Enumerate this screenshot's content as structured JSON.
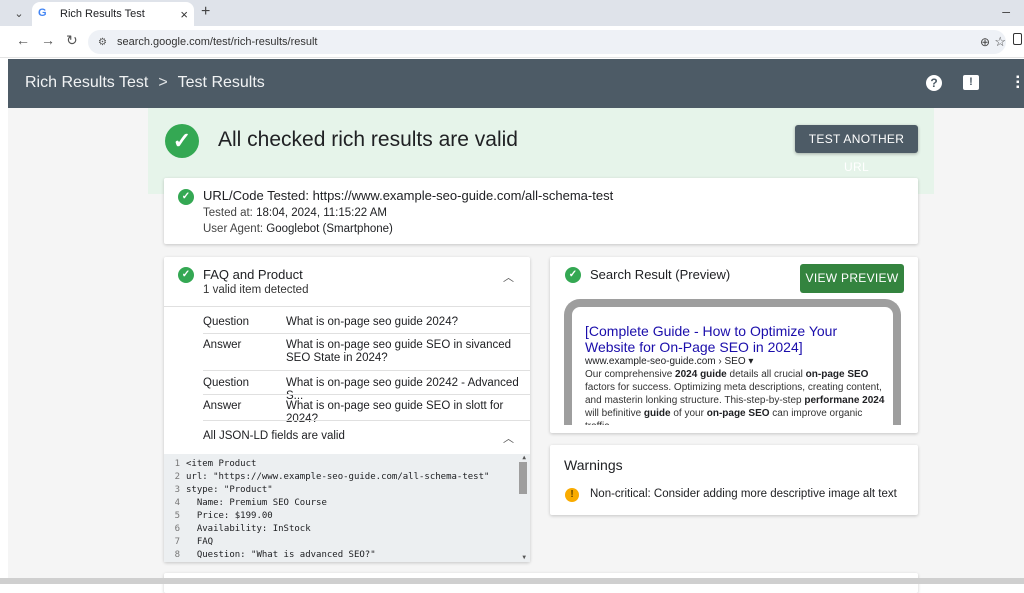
{
  "browser": {
    "tab_title": "Rich Results Test",
    "tab_close": "×",
    "new_tab": "+",
    "url": "search.google.com/test/rich-results/result"
  },
  "app": {
    "breadcrumb": [
      "Rich Results Test",
      "Test Results"
    ],
    "separator": ">"
  },
  "banner": {
    "title": "All checked rich results are valid",
    "button": "TEST ANOTHER URL",
    "color": "#34a853"
  },
  "url_card": {
    "label": "URL/Code Tested:",
    "url": "https://www.example-seo-guide.com/all-schema-test",
    "tested_at_label": "Tested at:",
    "tested_at": "18:04, 2024, 11:15:22 AM",
    "user_agent_label": "User Agent:",
    "user_agent": "Googlebot (Smartphone)"
  },
  "faq_card": {
    "title": "FAQ and Product",
    "subtitle": "1 valid item detected",
    "rows": [
      {
        "k": "Question",
        "v": "What is on-page seo guide 2024?"
      },
      {
        "k": "Answer",
        "v": "What is on-page seo guide SEO in sivanced SEO State in 2024?"
      },
      {
        "k": "Question",
        "v": "What is on-page seo guide 20242 - Advanced S..."
      },
      {
        "k": "Answer",
        "v": "What is on-page seo guide SEO in slott for 2024?"
      }
    ],
    "jsonld_label": "All JSON-LD fields are valid",
    "code": [
      "<item Product",
      "url: \"https://www.example-seo-guide.com/all-schema-test\"",
      "stype: \"Product\"",
      "  Name: Premium SEO Course",
      "  Price: $199.00",
      "  Availability: InStock",
      "  FAQ",
      "  Question: \"What is advanced SEO?\""
    ]
  },
  "preview_card": {
    "title": "Search Result (Preview)",
    "button": "VIEW PREVIEW",
    "serp_title": "[Complete Guide - How to Optimize Your Website for On-Page SEO in 2024]",
    "serp_url": "www.example-seo-guide.com › SEO ▾",
    "serp_desc": [
      {
        "t": "Our comprehensive ",
        "b": false
      },
      {
        "t": "2024 guide",
        "b": true
      },
      {
        "t": " details all crucial ",
        "b": false
      },
      {
        "t": "on-page SEO",
        "b": true
      },
      {
        "t": " factors for success. Optimizing meta descriptions, creating content, and masterin lonking structure. This-step-by-step ",
        "b": false
      },
      {
        "t": "performane 2024",
        "b": true
      },
      {
        "t": " will befinitive ",
        "b": false
      },
      {
        "t": "guide",
        "b": true
      },
      {
        "t": " of your ",
        "b": false
      },
      {
        "t": "on-page SEO",
        "b": true
      },
      {
        "t": " can improve organic traffic.",
        "b": false
      }
    ],
    "button_color": "#34843f"
  },
  "warnings": {
    "title": "Warnings",
    "items": [
      "Non-critical: Consider adding more descriptive image alt text"
    ],
    "icon_color": "#f9ab00"
  }
}
